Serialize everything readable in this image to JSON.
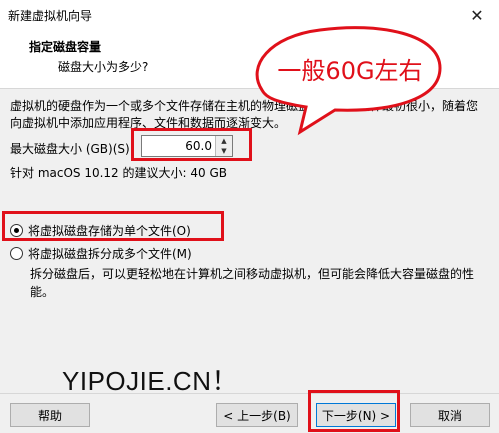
{
  "window": {
    "title": "新建虚拟机向导",
    "close_glyph": "✕"
  },
  "header": {
    "title": "指定磁盘容量",
    "subtitle": "磁盘大小为多少?"
  },
  "description": "虚拟机的硬盘作为一个或多个文件存储在主机的物理磁盘中。这些文件最初很小，随着您向虚拟机中添加应用程序、文件和数据而逐渐变大。",
  "disk_size": {
    "label": "最大磁盘大小 (GB)(S):",
    "value": "60.0"
  },
  "recommendation": "针对 macOS 10.12 的建议大小: 40 GB",
  "options": {
    "single_file": {
      "label": "将虚拟磁盘存储为单个文件(O)",
      "selected": true
    },
    "multi_file": {
      "label": "将虚拟磁盘拆分成多个文件(M)",
      "selected": false
    }
  },
  "split_description": "拆分磁盘后，可以更轻松地在计算机之间移动虚拟机，但可能会降低大容量磁盘的性能。",
  "annotation": {
    "text": "一般60G左右",
    "color": "#e0101a"
  },
  "watermark": "YIPOJIE.CN！",
  "buttons": {
    "help": "帮助",
    "back": "< 上一步(B)",
    "next": "下一步(N) >",
    "cancel": "取消"
  }
}
